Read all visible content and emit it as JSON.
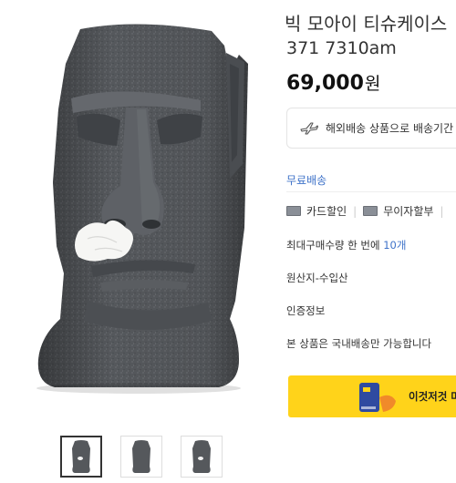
{
  "product": {
    "title": "빅 모아이 티슈케이스",
    "subtitle": "371 7310am",
    "price": "69,000",
    "price_unit": "원"
  },
  "shipping": {
    "overseas_note": "해외배송 상품으로 배송기간",
    "free_shipping": "무료배송"
  },
  "benefits": [
    {
      "label": "카드할인",
      "icon": "card-icon"
    },
    {
      "label": "무이자할부",
      "icon": "installment-icon"
    }
  ],
  "purchase": {
    "max_prefix": "최대구매수량 한 번에",
    "max_value": "10개"
  },
  "details": {
    "origin": "원산지-수입산",
    "certification": "인증정보",
    "domestic_only": "본 상품은 국내배송만 가능합니다"
  },
  "banner": {
    "text": "이것저것 머"
  },
  "colors": {
    "accent_blue": "#3f73c9",
    "banner_yellow": "#ffd31a",
    "stone_gray": "#55585c"
  },
  "thumbnails": [
    {
      "icon": "moai-thumbnail",
      "selected": true
    },
    {
      "icon": "moai-thumbnail",
      "selected": false
    },
    {
      "icon": "moai-thumbnail",
      "selected": false
    }
  ]
}
